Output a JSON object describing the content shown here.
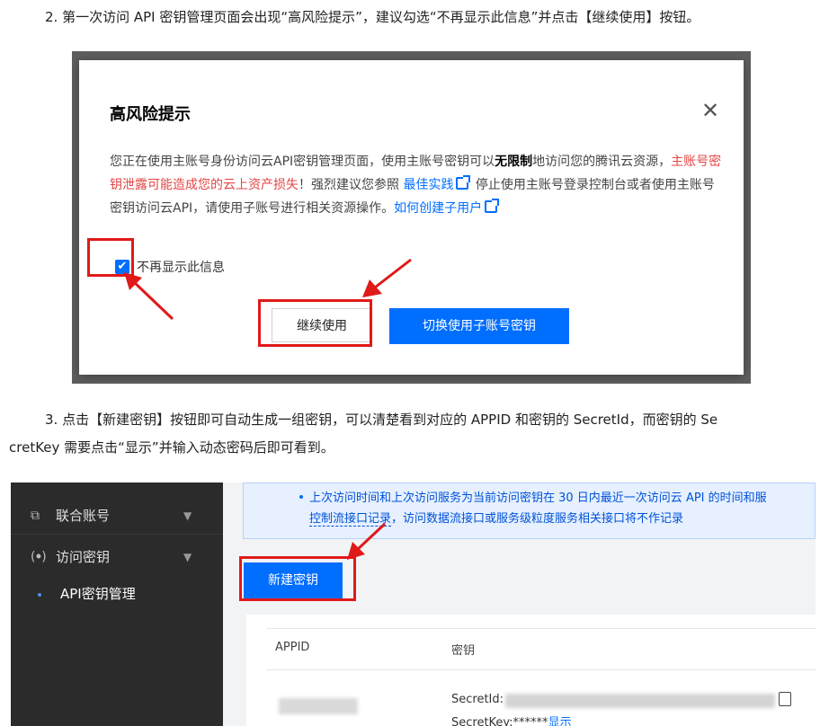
{
  "step2": {
    "text": "2. 第一次访问 API 密钥管理页面会出现“高风险提示”，建议勾选“不再显示此信息”并点击【继续使用】按钮。"
  },
  "dialog": {
    "title": "高风险提示",
    "close_icon": "close-icon",
    "body": {
      "part1": "您正在使用主账号身份访问云API密钥管理页面，使用主账号密钥可以",
      "bold": "无限制",
      "part2": "地访问您的腾讯云资源，",
      "warning": "主账号密钥泄露可能造成您的云上资产损失",
      "part3": "！强烈建议您参照",
      "link1": "最佳实践",
      "part4": "停止使用主账号登录控制台或者使用主账号密钥访问云API，请使用子账号进行相关资源操作。",
      "link2": "如何创建子用户"
    },
    "checkbox_label": "不再显示此信息",
    "checkbox_checked": true,
    "continue_button": "继续使用",
    "switch_button": "切换使用子账号密钥"
  },
  "step3": {
    "line1": "3. 点击【新建密钥】按钮即可自动生成一组密钥，可以清楚看到对应的 APPID 和密钥的 SecretId，而密钥的 Se",
    "line2": "cretKey 需要点击“显示”并输入动态密码后即可看到。"
  },
  "console": {
    "sidebar": [
      {
        "label": "联合账号",
        "icon": "federated-account-icon"
      },
      {
        "label": "访问密钥",
        "icon": "access-key-icon"
      }
    ],
    "sidebar_sub": "API密钥管理",
    "notice": {
      "line1": "上次访问时间和上次访问服务为当前访问密钥在 30 日内最近一次访问云 API 的时间和服",
      "line2_a": "控制流接口记录",
      "line2_b": "，访问数据流接口或服务级粒度服务相关接口将不作记录"
    },
    "new_key_button": "新建密钥",
    "table": {
      "headers": [
        "APPID",
        "密钥"
      ],
      "secret_id_label": "SecretId:",
      "secret_key_label": "SecretKey:******",
      "show_link": "显示"
    }
  },
  "colors": {
    "primary": "#006eff",
    "warning": "#e54545",
    "highlight": "#e01919"
  }
}
